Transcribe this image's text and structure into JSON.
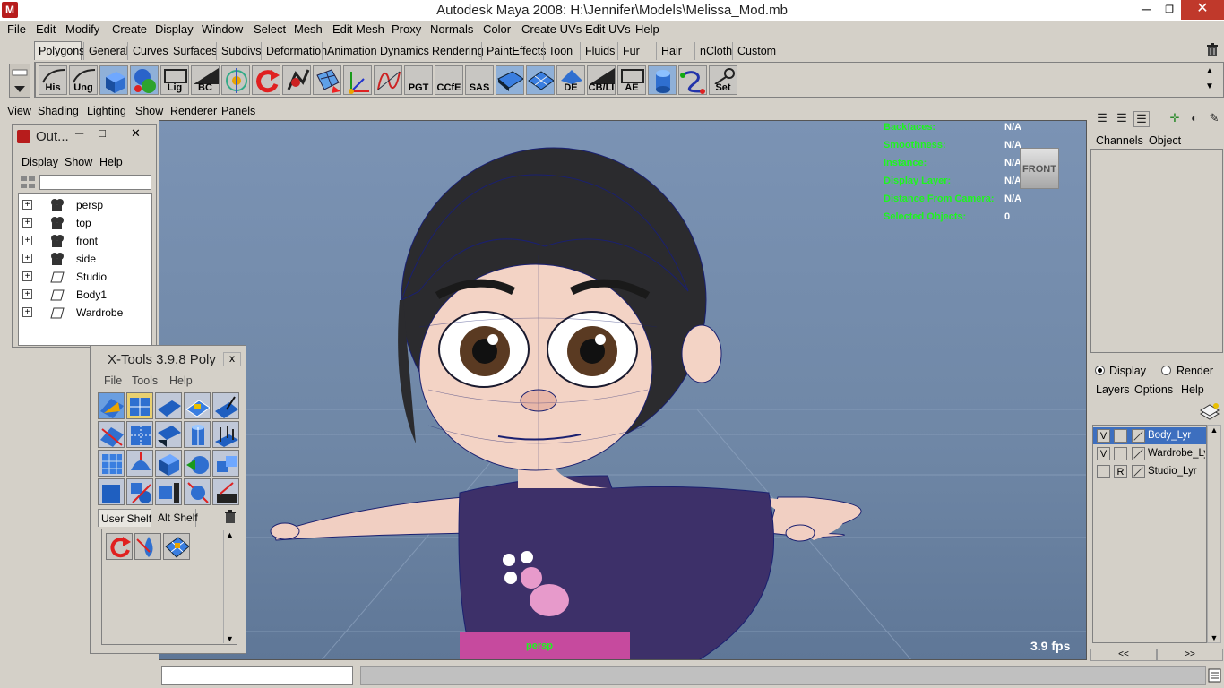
{
  "window": {
    "title": "Autodesk Maya 2008: H:\\Jennifer\\Models\\Melissa_Mod.mb",
    "minimize": "─",
    "maximize": "❐",
    "close": "✕"
  },
  "menubar": [
    "File",
    "Edit",
    "Modify",
    "Create",
    "Display",
    "Window",
    "Select",
    "Mesh",
    "Edit Mesh",
    "Proxy",
    "Normals",
    "Color",
    "Create UVs",
    "Edit UVs",
    "Help"
  ],
  "shelf_tabs": [
    "Polygons",
    "General",
    "Curves",
    "Surfaces",
    "Subdivs",
    "Deformation",
    "Animation",
    "Dynamics",
    "Rendering",
    "PaintEffects",
    "Toon",
    "Fluids",
    "Fur",
    "Hair",
    "nCloth",
    "Custom"
  ],
  "shelf_buttons": [
    "His",
    "Ung",
    "",
    "",
    "Lig",
    "BC",
    "",
    "",
    "",
    "",
    "",
    "",
    "PGT",
    "CCfE",
    "SAS",
    "",
    "",
    "DE",
    "CB/LI",
    "AE",
    "",
    "",
    "Set"
  ],
  "panel_menu": [
    "View",
    "Shading",
    "Lighting",
    "Show",
    "Renderer",
    "Panels"
  ],
  "hud": {
    "rows": [
      {
        "label": "Backfaces:",
        "value": "N/A"
      },
      {
        "label": "Smoothness:",
        "value": "N/A"
      },
      {
        "label": "Instance:",
        "value": "N/A"
      },
      {
        "label": "Display Layer:",
        "value": "N/A"
      },
      {
        "label": "Distance From Camera:",
        "value": "N/A"
      },
      {
        "label": "Selected Objects:",
        "value": "0"
      }
    ],
    "fps": "3.9 fps",
    "camera": "persp",
    "viewcube": "FRONT",
    "label_color": "#1ef51e"
  },
  "outliner": {
    "title": "Out...",
    "menu": [
      "Display",
      "Show",
      "Help"
    ],
    "items": [
      {
        "label": "persp",
        "type": "camera-icon"
      },
      {
        "label": "top",
        "type": "camera-icon"
      },
      {
        "label": "front",
        "type": "camera-icon"
      },
      {
        "label": "side",
        "type": "camera-icon"
      },
      {
        "label": "Studio",
        "type": "group-icon"
      },
      {
        "label": "Body1",
        "type": "group-icon"
      },
      {
        "label": "Wardrobe",
        "type": "group-icon"
      }
    ]
  },
  "xtools": {
    "title": "X-Tools 3.9.8 Poly",
    "close": "x",
    "menu": [
      "File",
      "Tools",
      "Help"
    ],
    "shelf_tabs": [
      "User Shelf",
      "Alt Shelf"
    ]
  },
  "channel_box": {
    "tabs": [
      "Channels",
      "Object"
    ]
  },
  "layers": {
    "modes": [
      "Display",
      "Render"
    ],
    "selected_mode": "Display",
    "menu": [
      "Layers",
      "Options",
      "Help"
    ],
    "rows": [
      {
        "v": "V",
        "r": "",
        "name": "Body_Lyr",
        "selected": true
      },
      {
        "v": "V",
        "r": "",
        "name": "Wardrobe_Lyr",
        "selected": false
      },
      {
        "v": "",
        "r": "R",
        "name": "Studio_Lyr",
        "selected": false
      }
    ],
    "pager": [
      "<<",
      ">>"
    ]
  },
  "colors": {
    "hud_green": "#1ef51e",
    "layer_selected": "#3d6fbf",
    "close_red": "#c0392b"
  }
}
